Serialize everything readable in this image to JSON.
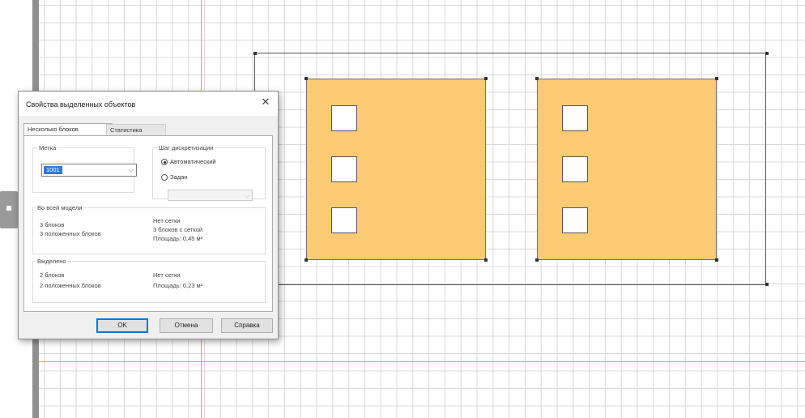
{
  "dialog": {
    "title": "Свойства выделенных объектов",
    "close_symbol": "✕",
    "tabs": [
      "Несколько блоков",
      "Статистика"
    ],
    "label_group": {
      "caption": "Метка",
      "selected_value": "1001",
      "chevron": "⌵"
    },
    "discretization": {
      "caption": "Шаг дискретизации",
      "auto_option": "Автоматический",
      "set_option": "Задан",
      "selected": "auto"
    },
    "whole_model": {
      "caption": "Во всей модели",
      "blocks": "3 блоков",
      "filled_blocks": "3 положенных блоков",
      "no_mesh": "Нет сетки",
      "mesh_blocks": "3 блоков с сеткой",
      "area": "Площадь: 0,45 м²"
    },
    "selected": {
      "caption": "Выделено",
      "blocks": "2 блоков",
      "filled_blocks": "2 положенных блоков",
      "no_mesh": "Нет сетки",
      "area": "Площадь: 0,23 м²"
    },
    "buttons": {
      "ok": "OK",
      "cancel": "Отмена",
      "help": "Справка"
    }
  },
  "colors": {
    "block_fill": "#fbcb73",
    "axis": "#d9a955",
    "grid": "#d8d8d8",
    "default_button_border": "#0078d7"
  }
}
